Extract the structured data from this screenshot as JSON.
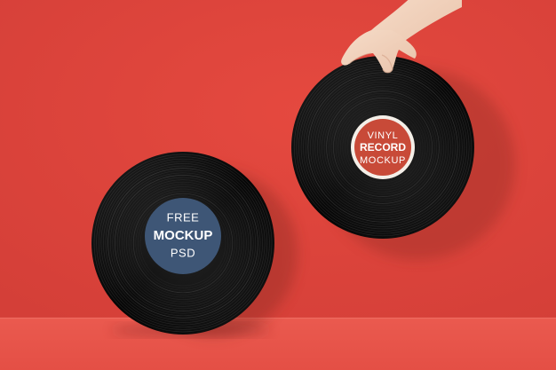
{
  "scene": {
    "background_color": "#e0463f",
    "floor_color": "#e8584d",
    "vinyl_color": "#111111"
  },
  "record_left": {
    "label_color": "#3e5676",
    "label_text_color": "#ffffff",
    "label_lines": [
      "FREE",
      "MOCKUP",
      "PSD"
    ]
  },
  "record_right": {
    "label_color": "#c84a38",
    "label_ring_color": "#f4efe8",
    "label_text_color": "#ffffff",
    "label_lines": [
      "VINYL",
      "RECORD",
      "MOCKUP"
    ],
    "held_by": "hand"
  }
}
